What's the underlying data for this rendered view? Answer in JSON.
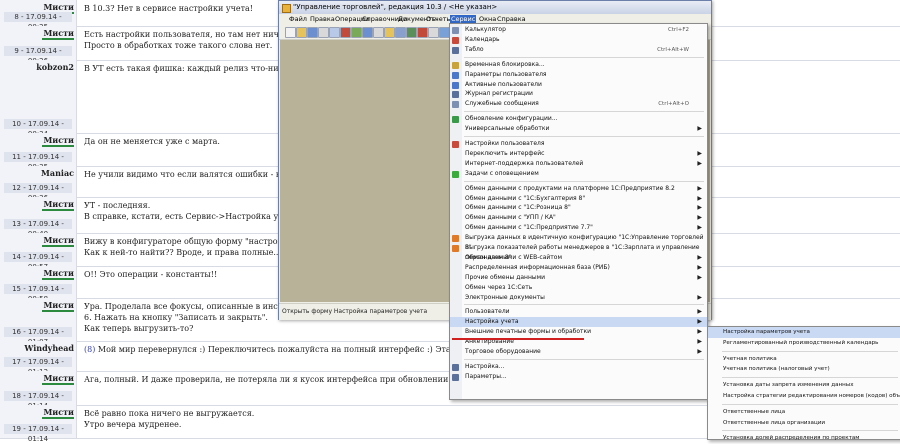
{
  "forum": {
    "posts": [
      {
        "author": "Мисти",
        "date": "8 - 17.09.14 - 00:25",
        "lines": [
          "В 10.3? Нет в сервисе настройки учета!"
        ],
        "ucolor": "#2b8a3e"
      },
      {
        "author": "Мисти",
        "date": "9 - 17.09.14 - 00:26",
        "lines": [
          "Есть настройки пользователя, но там нет ничего подходящего",
          "Просто в обработках тоже такого слова нет."
        ],
        "ucolor": "#2b8a3e"
      },
      {
        "author": "kobzon2",
        "date": "10 - 17.09.14 - 00:34",
        "lines": [
          "В УТ есть такая фишка: каждый релиз что-нибудь перенес"
        ],
        "ucolor": ""
      },
      {
        "author": "Мисти",
        "date": "11 - 17.09.14 - 00:35",
        "lines": [
          "Да он не меняется уже с марта."
        ],
        "ucolor": "#2b8a3e"
      },
      {
        "author": "Maniac",
        "date": "12 - 17.09.14 - 00:36",
        "lines": [
          "Не учили видимо что если валятся ошибки - надо проверят"
        ],
        "ucolor": ""
      },
      {
        "author": "Мисти",
        "date": "13 - 17.09.14 - 00:40",
        "lines": [
          "УТ - последняя.",
          "В справке, кстати, есть Сервис->Настройка учета->Настро"
        ],
        "ucolor": "#2b8a3e"
      },
      {
        "author": "Мисти",
        "date": "14 - 17.09.14 - 00:57",
        "lines": [
          "Вижу в конфигураторе общую форму \"настройка параметр",
          "Как к ней-то найти?? Вроде, и права полные..."
        ],
        "ucolor": "#2b8a3e"
      },
      {
        "author": "Мисти",
        "date": "15 - 17.09.14 - 00:58",
        "lines": [
          "О!! Это операции - константы!!"
        ],
        "ucolor": "#2b8a3e"
      },
      {
        "author": "Мисти",
        "date": "16 - 17.09.14 - 01:07",
        "lines": [
          "Ура. Проделала все фокусы, описанные в инструкции, вплоть",
          "6. Нажать на кнопку \"Записать и закрыть\".",
          "Как теперь выгрузить-то?"
        ],
        "ucolor": "#2b8a3e"
      },
      {
        "author": "Windyhead",
        "date": "17 - 17.09.14 - 01:12",
        "lines": [
          "(8) Мой мир перевернулся :) Переключитесь пожалуйста на полный интерфейс :) Эта закладка там уже сколько"
        ],
        "ucolor": ""
      },
      {
        "author": "Мисти",
        "date": "18 - 17.09.14 - 01:14",
        "lines": [
          "Ага, полный. И даже проверила, не потеряла ли я кусок интерфейса при обновлении."
        ],
        "ucolor": "#2b8a3e"
      },
      {
        "author": "Мисти",
        "date": "19 - 17.09.14 - 01:14",
        "lines": [
          "Всё равно пока ничего не выгружается.",
          "Утро вечера мудренее."
        ],
        "ucolor": "#2b8a3e"
      }
    ]
  },
  "window": {
    "title": "\"Управление торговлей\", редакция 10.3 / <Не указан>",
    "menu": [
      "Файл",
      "Правка",
      "Операции",
      "Справочники",
      "Документы",
      "Отчеты",
      "Сервис",
      "Окна",
      "Справка"
    ],
    "active_menu": "Сервис",
    "status": "Открыть форму Настройка параметров учета"
  },
  "service_menu": [
    {
      "label": "Калькулятор",
      "shortcut": "Ctrl+F2",
      "icon": "calculator-icon",
      "color": "#7d8fb3"
    },
    {
      "label": "Календарь",
      "icon": "calendar-icon",
      "color": "#c94a3b"
    },
    {
      "label": "Табло",
      "shortcut": "Ctrl+Alt+W",
      "icon": "display-board-icon",
      "color": "#5a6f9a"
    },
    {
      "sep": true
    },
    {
      "label": "Временная блокировка...",
      "icon": "lock-icon",
      "color": "#c9a23b"
    },
    {
      "label": "Параметры пользователя",
      "icon": "user-settings-icon",
      "color": "#4a77c9"
    },
    {
      "label": "Активные пользователи",
      "icon": "active-users-icon",
      "color": "#4a77c9"
    },
    {
      "label": "Журнал регистрации",
      "icon": "log-icon",
      "color": "#5a6f9a"
    },
    {
      "label": "Служебные сообщения",
      "shortcut": "Ctrl+Alt+O",
      "icon": "messages-icon",
      "color": "#7d8fb3"
    },
    {
      "sep": true
    },
    {
      "label": "Обновление конфигурации...",
      "icon": "update-icon",
      "color": "#3b9a4a"
    },
    {
      "label": "Универсальные обработки",
      "arrow": true
    },
    {
      "sep": true
    },
    {
      "label": "Настройки пользователя",
      "icon": "user-prefs-icon",
      "color": "#c94a3b"
    },
    {
      "label": "Переключить интерфейс",
      "arrow": true
    },
    {
      "label": "Интернет-поддержка пользователей",
      "arrow": true
    },
    {
      "label": "Задачи с оповещением",
      "icon": "tasks-icon",
      "color": "#3bab3b"
    },
    {
      "sep": true
    },
    {
      "label": "Обмен данными с продуктами на платформе 1С:Предприятие 8.2",
      "arrow": true
    },
    {
      "label": "Обмен данными с \"1С:Бухгалтерия 8\"",
      "arrow": true
    },
    {
      "label": "Обмен данными с \"1С:Розница 8\"",
      "arrow": true
    },
    {
      "label": "Обмен данными с \"УПП / КА\"",
      "arrow": true
    },
    {
      "label": "Обмен данными с \"1С:Предприятие 7.7\"",
      "arrow": true
    },
    {
      "label": "Выгрузка данных в идентичную конфигурацию \"1С:Управление торговлей 8\"",
      "icon": "export-icon",
      "color": "#e07a28"
    },
    {
      "label": "Выгрузка показателей работы менеджеров в \"1С:Зарплата и управление персоналом 8\"",
      "icon": "export-icon",
      "color": "#e07a28"
    },
    {
      "label": "Обмен данными с WEB-сайтом",
      "arrow": true
    },
    {
      "label": "Распределенная информационная база (РИБ)",
      "arrow": true
    },
    {
      "label": "Прочие обмены данными",
      "arrow": true
    },
    {
      "label": "Обмен через 1С:Сеть"
    },
    {
      "label": "Электронные документы",
      "arrow": true
    },
    {
      "sep": true
    },
    {
      "label": "Пользователи",
      "arrow": true
    },
    {
      "label": "Настройка учета",
      "arrow": true,
      "selected": true
    },
    {
      "label": "Внешние печатные формы и обработки",
      "arrow": true
    },
    {
      "label": "Анкетирование",
      "arrow": true
    },
    {
      "label": "Торговое оборудование",
      "arrow": true
    },
    {
      "sep": true
    },
    {
      "label": "Настройка...",
      "icon": "settings-icon",
      "color": "#5a6f9a"
    },
    {
      "label": "Параметры...",
      "icon": "params-icon",
      "color": "#5a6f9a"
    }
  ],
  "setup_submenu": [
    {
      "label": "Настройка параметров учета",
      "selected": true
    },
    {
      "label": "Регламентированный производственный календарь"
    },
    {
      "sep": true
    },
    {
      "label": "Учетная политика"
    },
    {
      "label": "Учетная политика (налоговый учет)"
    },
    {
      "sep": true
    },
    {
      "label": "Установка даты запрета изменения данных"
    },
    {
      "label": "Настройка стратегии редактирования номеров (кодов) объектов"
    },
    {
      "sep": true
    },
    {
      "label": "Ответственные лица"
    },
    {
      "label": "Ответственные лица организации"
    },
    {
      "sep": true
    },
    {
      "label": "Установка долей распределения по проектам"
    }
  ]
}
